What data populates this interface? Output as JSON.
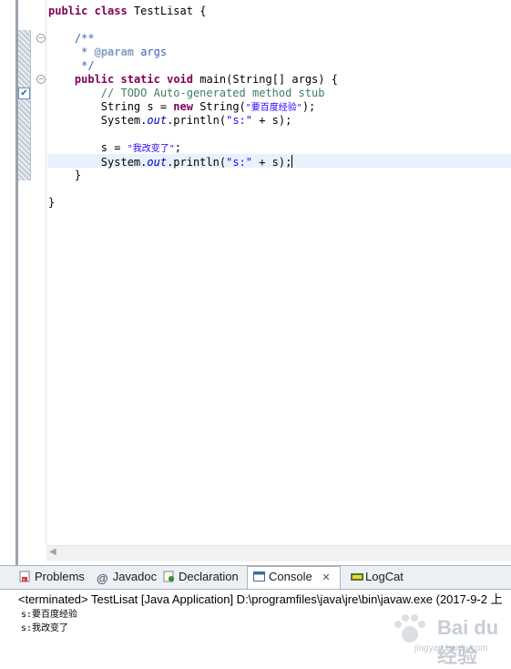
{
  "editor": {
    "lines": {
      "class_kw1": "public",
      "class_kw2": "class",
      "class_name": "TestLisat {",
      "doc_open": "/**",
      "doc_star": "*",
      "doc_tag": "@param",
      "doc_param": "args",
      "doc_close": "*/",
      "main_kw1": "public",
      "main_kw2": "static",
      "main_kw3": "void",
      "main_sig": "main(String[] args) {",
      "todo_comment": "// TODO Auto-generated method stub",
      "decl_prefix": "String s = ",
      "decl_new": "new",
      "decl_mid": " String(",
      "decl_str": "\"要百度经验\"",
      "decl_end": ");",
      "print1_a": "System.",
      "print1_out": "out",
      "print1_b": ".println(",
      "print1_str": "\"s:\"",
      "print1_c": " + s);",
      "assign_a": "s = ",
      "assign_str": "\"我改变了\"",
      "assign_end": ";",
      "print2_a": "System.",
      "print2_out": "out",
      "print2_b": ".println(",
      "print2_str": "\"s:\"",
      "print2_c": " + s);",
      "close_method": "}",
      "close_class": "}"
    }
  },
  "tabs": {
    "problems": "Problems",
    "javadoc": "Javadoc",
    "declaration": "Declaration",
    "console": "Console",
    "console_close": "✕",
    "logcat": "LogCat"
  },
  "console": {
    "status": "<terminated> TestLisat [Java Application] D:\\programfiles\\java\\jre\\bin\\javaw.exe (2017-9-2 上",
    "output": [
      "s:要百度经验",
      "s:我改变了"
    ]
  },
  "watermark": {
    "brand": "Bai du 经验",
    "url": "jingyan.baidu.com"
  }
}
